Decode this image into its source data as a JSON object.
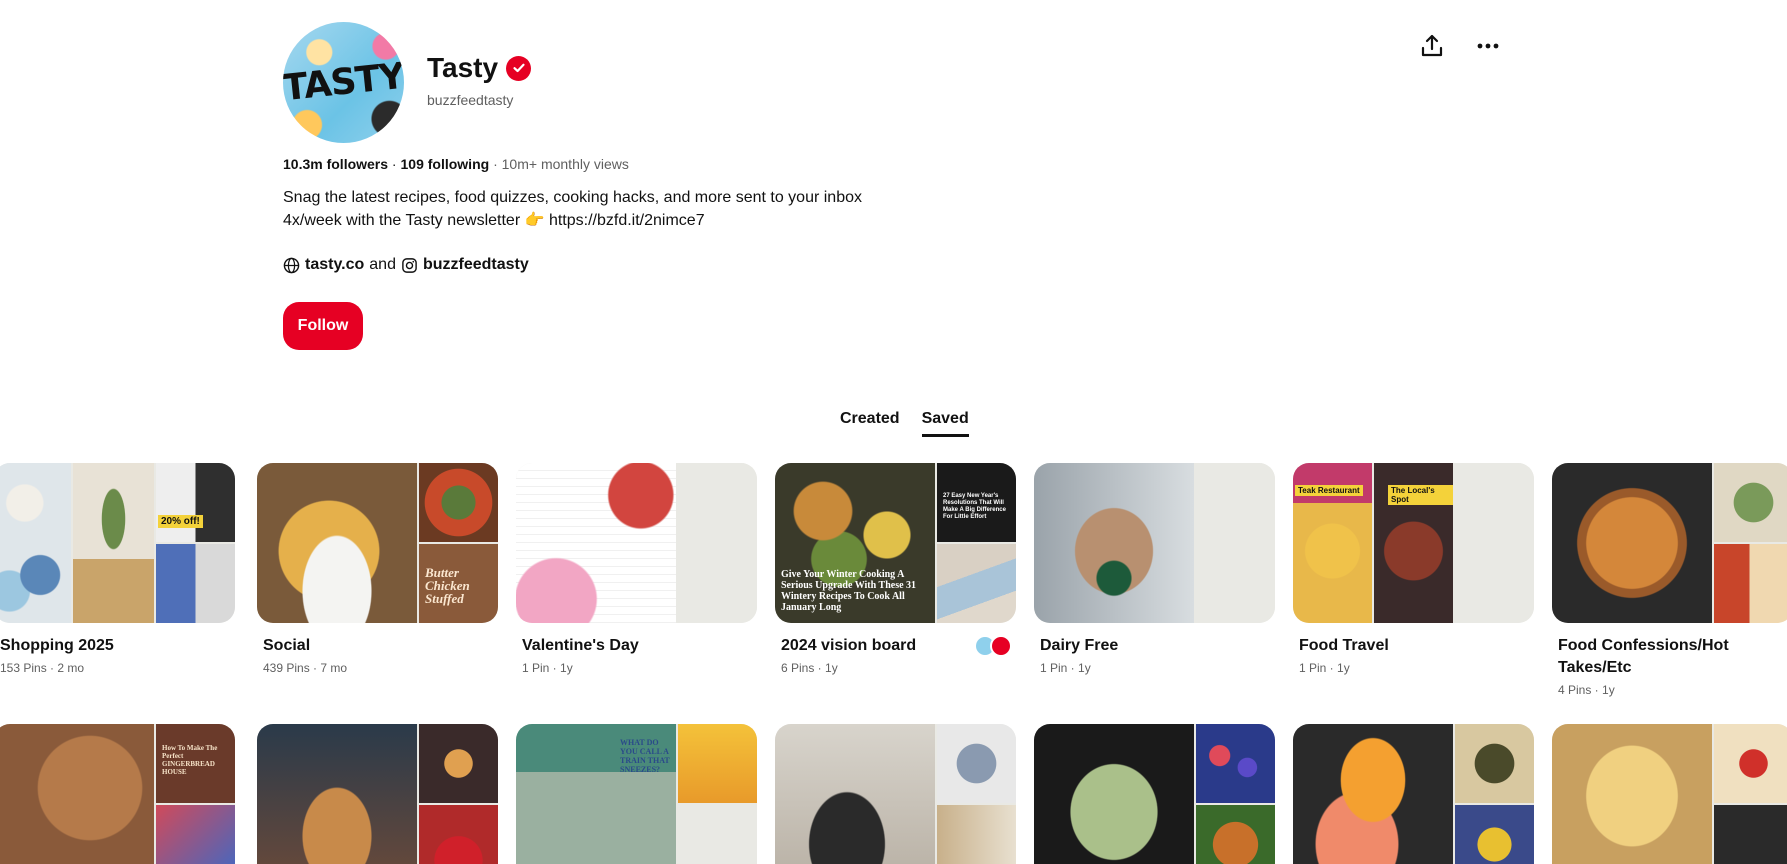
{
  "profile": {
    "avatar_text": "TASTY",
    "name": "Tasty",
    "handle": "buzzfeedtasty",
    "followers": "10.3m followers",
    "separator": " · ",
    "following": "109 following",
    "monthly_views": "10m+ monthly views",
    "bio": "Snag the latest recipes, food quizzes, cooking hacks, and more sent to your inbox 4x/week with the Tasty newsletter 👉 https://bzfd.it/2nimce7",
    "website": "tasty.co",
    "links_joiner": "and",
    "instagram": "buzzfeedtasty",
    "follow_label": "Follow"
  },
  "actions": {
    "share_icon": "share-icon",
    "more_icon": "more-icon"
  },
  "tabs": [
    {
      "label": "Created",
      "active": false
    },
    {
      "label": "Saved",
      "active": true
    }
  ],
  "boards_row1": [
    {
      "title": "Shopping 2025",
      "meta": "153 Pins · 2 mo",
      "badge": "20% off!"
    },
    {
      "title": "Social",
      "meta": "439 Pins · 7 mo",
      "overlay": "Butter Chicken Stuffed"
    },
    {
      "title": "Valentine's Day",
      "meta": "1 Pin · 1y"
    },
    {
      "title": "2024 vision board",
      "meta": "6 Pins · 1y",
      "overlay": "Give Your Winter Cooking A Serious Upgrade With These 31 Wintery Recipes To Cook All January Long",
      "overlay2": "27 Easy New Year's Resolutions That Will Make A Big Difference For Little Effort"
    },
    {
      "title": "Dairy Free",
      "meta": "1 Pin · 1y"
    },
    {
      "title": "Food Travel",
      "meta": "1 Pin · 1y",
      "tag1": "Teak Restaurant",
      "tag2": "The Local's Spot"
    },
    {
      "title": "Food Confessions/Hot Takes/Etc",
      "meta": "4 Pins · 1y"
    }
  ],
  "boards_row2": [
    {
      "overlay": "How To Make The Perfect GINGERBREAD HOUSE"
    },
    {},
    {
      "overlay": "WHAT DO YOU CALL A TRAIN THAT SNEEZES?"
    },
    {},
    {},
    {},
    {}
  ],
  "colors": {
    "accent": "#e60023",
    "muted_text": "#5f5f5f",
    "placeholder": "#e9e9e4"
  }
}
